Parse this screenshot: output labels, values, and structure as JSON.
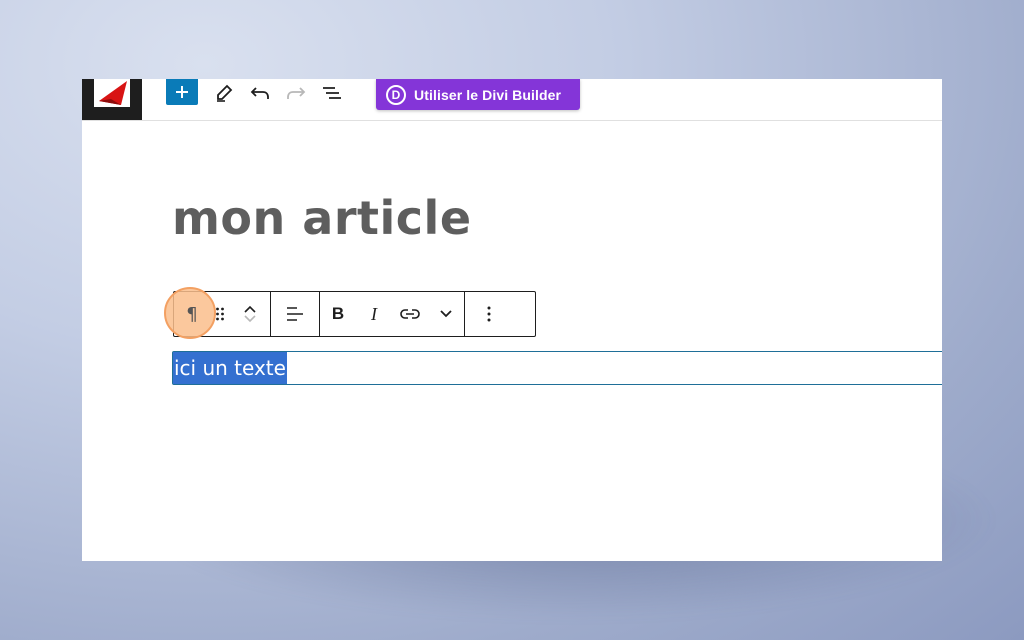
{
  "toolbar": {
    "add_block_label": "+",
    "divi_logo_letter": "D",
    "divi_button_label": "Utiliser le Divi Builder",
    "brand_color": "#8435d8",
    "accent_color": "#0a7bb8"
  },
  "editor": {
    "post_title": "mon article",
    "block_toolbar": {
      "paragraph_glyph": "¶",
      "bold_label": "B",
      "italic_label": "I"
    },
    "paragraph_text": "ici un texte",
    "selection_color": "#3470d0"
  }
}
